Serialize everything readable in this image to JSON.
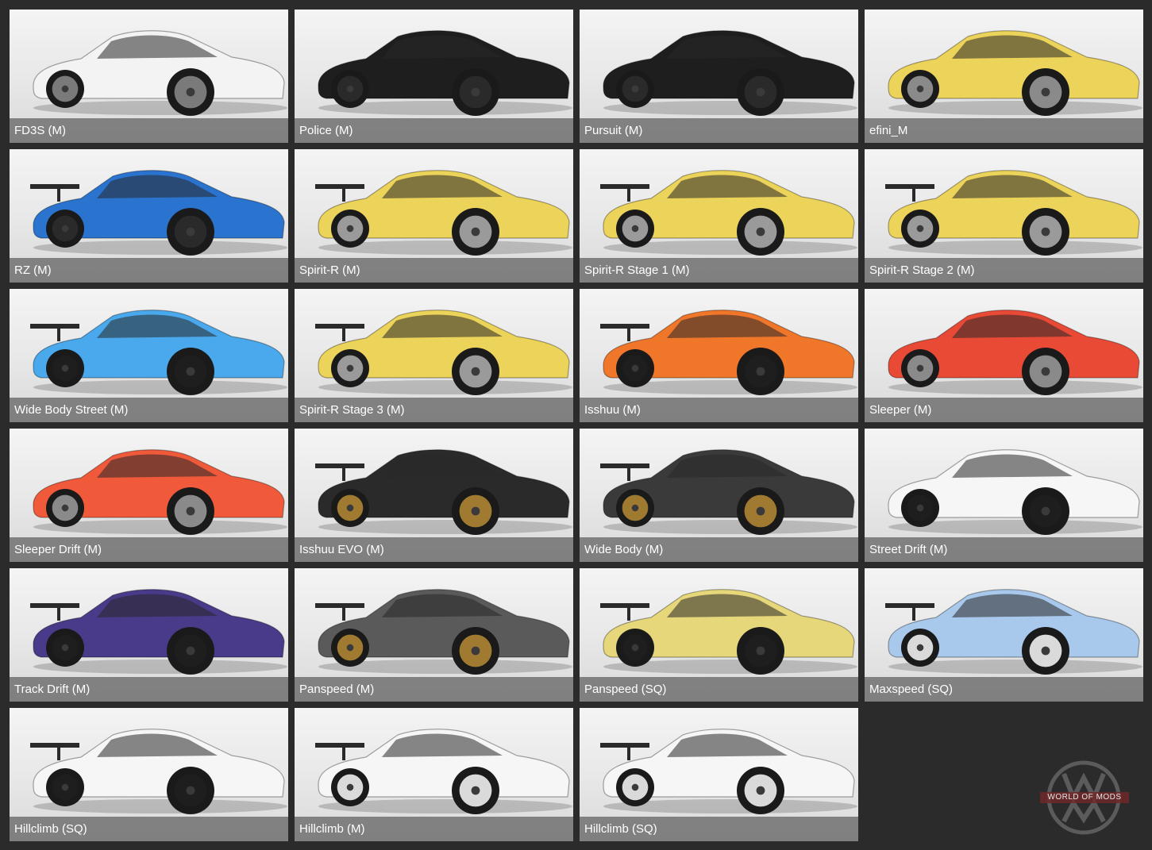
{
  "tiles": [
    {
      "label": "FD3S (M)",
      "body": "#f3f3f3",
      "wheel": "#7a7a7a",
      "wing": false
    },
    {
      "label": "Police (M)",
      "body": "#1e1e1e",
      "wheel": "#2a2a2a",
      "wing": false
    },
    {
      "label": "Pursuit (M)",
      "body": "#1e1e1e",
      "wheel": "#2a2a2a",
      "wing": false
    },
    {
      "label": "efini_M",
      "body": "#ecd35a",
      "wheel": "#8a8a8a",
      "wing": false
    },
    {
      "label": "RZ (M)",
      "body": "#2a74d0",
      "wheel": "#2a2a2a",
      "wing": true
    },
    {
      "label": "Spirit-R (M)",
      "body": "#ecd35a",
      "wheel": "#9a9a9a",
      "wing": true
    },
    {
      "label": "Spirit-R Stage 1 (M)",
      "body": "#ecd35a",
      "wheel": "#9a9a9a",
      "wing": true
    },
    {
      "label": "Spirit-R Stage 2 (M)",
      "body": "#ecd35a",
      "wheel": "#9a9a9a",
      "wing": true
    },
    {
      "label": "Wide Body Street (M)",
      "body": "#4aa8ec",
      "wheel": "#1e1e1e",
      "wing": true
    },
    {
      "label": "Spirit-R Stage 3 (M)",
      "body": "#ecd35a",
      "wheel": "#9a9a9a",
      "wing": true
    },
    {
      "label": "Isshuu (M)",
      "body": "#f0762a",
      "wheel": "#1e1e1e",
      "wing": true
    },
    {
      "label": "Sleeper (M)",
      "body": "#e84a36",
      "wheel": "#8a8a8a",
      "wing": false
    },
    {
      "label": "Sleeper Drift (M)",
      "body": "#f05a3a",
      "wheel": "#8a8a8a",
      "wing": false
    },
    {
      "label": "Isshuu EVO (M)",
      "body": "#2a2a2a",
      "wheel": "#a07a30",
      "wing": true
    },
    {
      "label": "Wide Body (M)",
      "body": "#3a3a3a",
      "wheel": "#a07a30",
      "wing": true
    },
    {
      "label": "Street Drift (M)",
      "body": "#f6f6f6",
      "wheel": "#1e1e1e",
      "wing": false
    },
    {
      "label": "Track Drift (M)",
      "body": "#4a3a8a",
      "wheel": "#1e1e1e",
      "wing": true
    },
    {
      "label": "Panspeed (M)",
      "body": "#5a5a5a",
      "wheel": "#a07a30",
      "wing": true
    },
    {
      "label": "Panspeed (SQ)",
      "body": "#e6d77a",
      "wheel": "#1e1e1e",
      "wing": true
    },
    {
      "label": "Maxspeed (SQ)",
      "body": "#a8c8ec",
      "wheel": "#dadada",
      "wing": true
    },
    {
      "label": "Hillclimb (SQ)",
      "body": "#f6f6f6",
      "wheel": "#1e1e1e",
      "wing": true
    },
    {
      "label": "Hillclimb (M)",
      "body": "#f6f6f6",
      "wheel": "#dadada",
      "wing": true
    },
    {
      "label": "Hillclimb (SQ)",
      "body": "#f6f6f6",
      "wheel": "#dadada",
      "wing": true
    }
  ],
  "watermark": {
    "text": "WORLD OF MODS"
  }
}
